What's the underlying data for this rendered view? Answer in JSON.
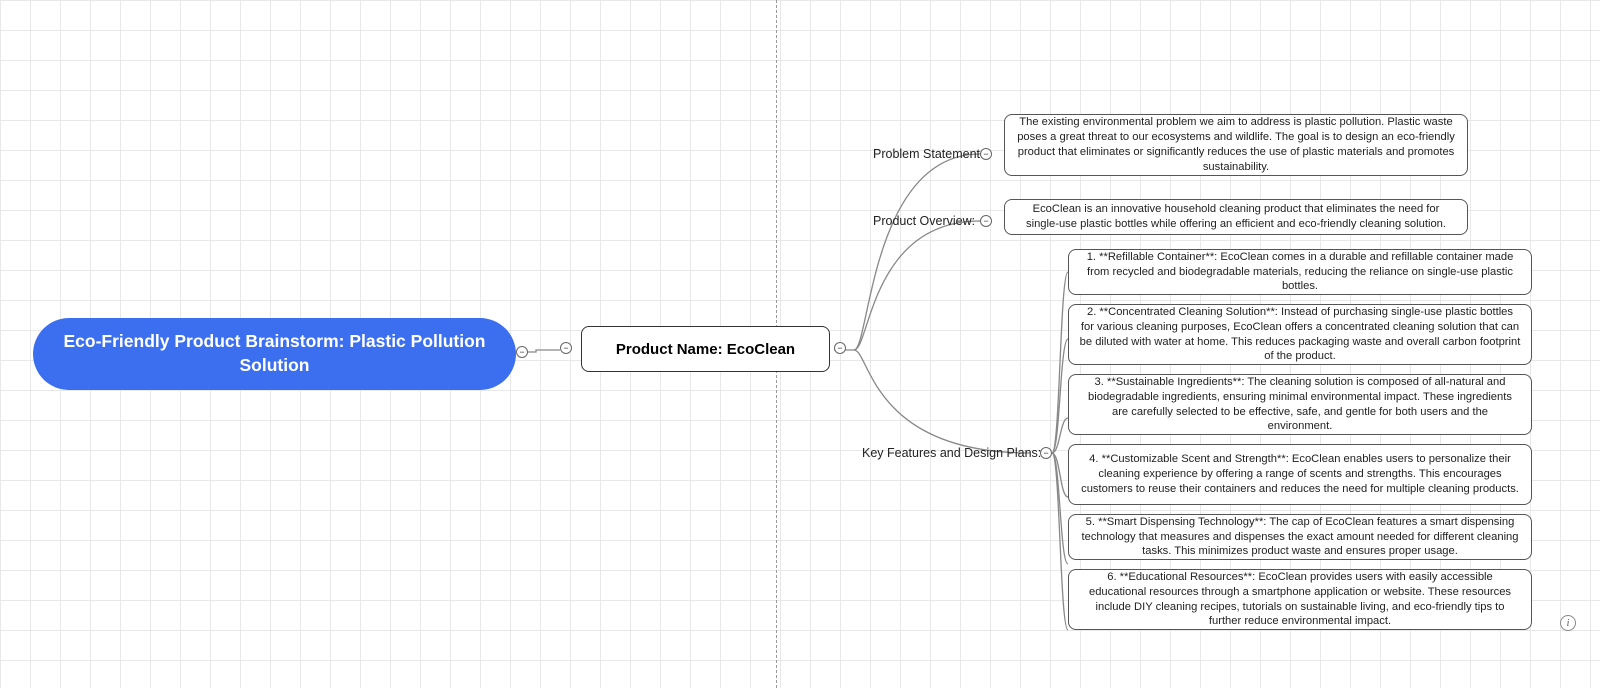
{
  "root": {
    "title": "Eco-Friendly Product Brainstorm: Plastic Pollution Solution"
  },
  "level1": {
    "title": "Product Name: EcoClean"
  },
  "branches": {
    "problem": {
      "label": "Problem Statement:",
      "text": "The existing environmental problem we aim to address is plastic pollution. Plastic waste poses a great threat to our ecosystems and wildlife. The goal is to design an eco-friendly product that eliminates or significantly reduces the use of plastic materials and promotes sustainability."
    },
    "overview": {
      "label": "Product Overview:",
      "text": "EcoClean is an innovative household cleaning product that eliminates the need for single-use plastic bottles while offering an efficient and eco-friendly cleaning solution."
    },
    "features": {
      "label": "Key Features and Design Plans:",
      "items": [
        "1. **Refillable Container**: EcoClean comes in a durable and refillable container made from recycled and biodegradable materials, reducing the reliance on single-use plastic bottles.",
        "2. **Concentrated Cleaning Solution**: Instead of purchasing single-use plastic bottles for various cleaning purposes, EcoClean offers a concentrated cleaning solution that can be diluted with water at home. This reduces packaging waste and overall carbon footprint of the product.",
        "3. **Sustainable Ingredients**: The cleaning solution is composed of all-natural and biodegradable ingredients, ensuring minimal environmental impact. These ingredients are carefully selected to be effective, safe, and gentle for both users and the environment.",
        "4. **Customizable Scent and Strength**: EcoClean enables users to personalize their cleaning experience by offering a range of scents and strengths. This encourages customers to reuse their containers and reduces the need for multiple cleaning products.",
        "5. **Smart Dispensing Technology**: The cap of EcoClean features a smart dispensing technology that measures and dispenses the exact amount needed for different cleaning tasks. This minimizes product waste and ensures proper usage.",
        "6. **Educational Resources**: EcoClean provides users with easily accessible educational resources through a smartphone application or website. These resources include DIY cleaning recipes, tutorials on sustainable living, and eco-friendly tips to further reduce environmental impact."
      ]
    }
  }
}
